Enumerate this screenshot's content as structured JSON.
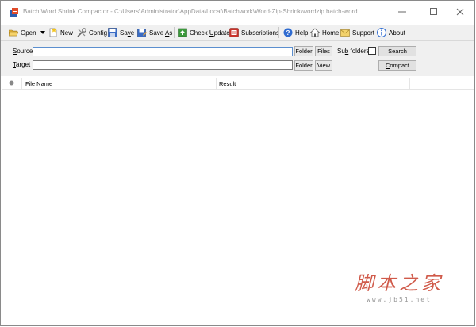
{
  "window": {
    "title": "Batch Word Shrink Compactor - C:\\Users\\Administrator\\AppData\\Local\\Batchwork\\Word-Zip-Shrink\\wordzip.batch-word...",
    "controls": {
      "minimize": "—",
      "maximize": "☐",
      "close": "✕"
    }
  },
  "toolbar": {
    "open": "Open",
    "new": "New",
    "config": "Config",
    "save": "Save",
    "save_as": "Save As",
    "check_update": "Check Update",
    "subscriptions": "Subscriptions",
    "help": "Help",
    "home": "Home",
    "support": "Support",
    "about": "About"
  },
  "form": {
    "source_label": "Source",
    "target_label": "Target",
    "source_value": "",
    "target_value": "",
    "source_folder": "Folder",
    "source_files": "Files",
    "subfolders_label": "Sub folders",
    "subfolders_checked": false,
    "search": "Search",
    "target_folder": "Folder",
    "target_view": "View",
    "compact": "Compact"
  },
  "list": {
    "columns": [
      "File Name",
      "Result"
    ],
    "rows": []
  },
  "watermark": {
    "main": "脚本之家",
    "sub": "www.jb51.net"
  }
}
